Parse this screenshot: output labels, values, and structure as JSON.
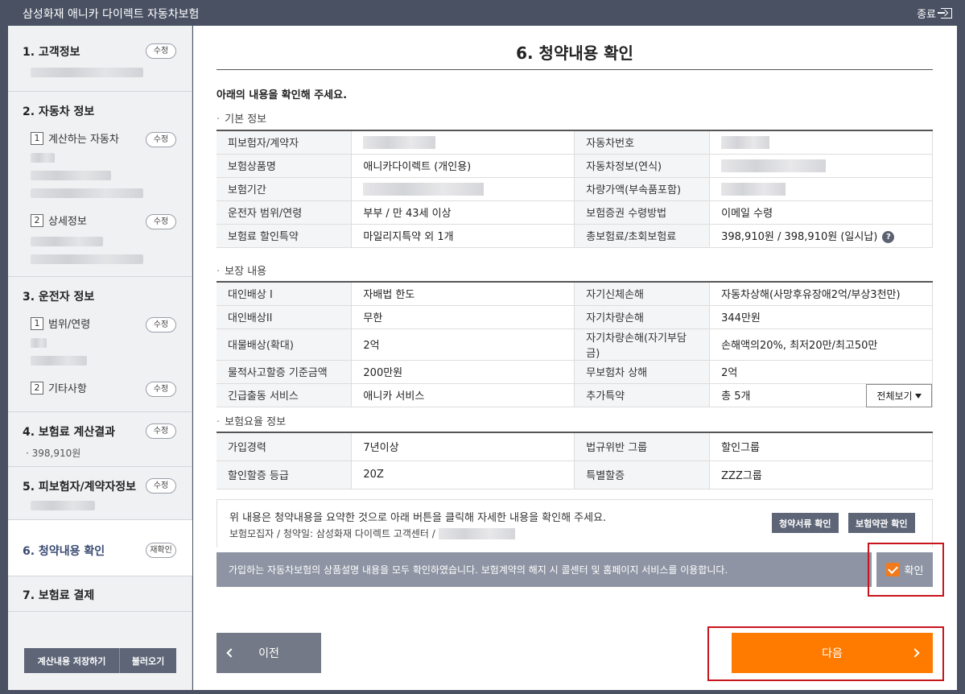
{
  "app": {
    "title": "삼성화재 애니카 다이렉트 자동차보험",
    "close_label": "종료"
  },
  "sidebar": {
    "s1_title": "1. 고객정보",
    "edit_label": "수정",
    "s2_title": "2. 자동차 정보",
    "s2_sub1_num": "1",
    "s2_sub1": "계산하는 자동차",
    "s2_sub2_num": "2",
    "s2_sub2": "상세정보",
    "s3_title": "3. 운전자 정보",
    "s3_sub1_num": "1",
    "s3_sub1": "범위/연령",
    "s3_sub2_num": "2",
    "s3_sub2": "기타사항",
    "s4_title": "4. 보험료 계산결과",
    "s4_note": "· 398,910원",
    "s5_title": "5. 피보험자/계약자정보",
    "s6_title": "6. 청약내용 확인",
    "recheck_label": "재확인",
    "s7_title": "7. 보험료 결제",
    "save_label": "계산내용 저장하기",
    "load_label": "불러오기"
  },
  "main": {
    "page_title": "6. 청약내용 확인",
    "intro": "아래의 내용을 확인해 주세요.",
    "basic_label": "기본 정보",
    "basic": [
      [
        "피보험자/계약자",
        "",
        "자동차번호",
        ""
      ],
      [
        "보험상품명",
        "애니카다이렉트 (개인용)",
        "자동차정보(연식)",
        ""
      ],
      [
        "보험기간",
        "",
        "차량가액(부속품포함)",
        ""
      ],
      [
        "운전자 범위/연령",
        "부부 / 만 43세 이상",
        "보험증권 수령방법",
        "이메일 수령"
      ],
      [
        "보험료 할인특약",
        "마일리지특약 외 1개",
        "총보험료/초회보험료",
        "398,910원 / 398,910원 (일시납)"
      ]
    ],
    "coverage_label": "보장 내용",
    "coverage": [
      [
        "대인배상 I",
        "자배법 한도",
        "자기신체손해",
        "자동차상해(사망후유장애2억/부상3천만)"
      ],
      [
        "대인배상II",
        "무한",
        "자기차량손해",
        "344만원"
      ],
      [
        "대물배상(확대)",
        "2억",
        "자기차량손해(자기부담금)",
        "손해액의20%, 최저20만/최고50만"
      ],
      [
        "물적사고할증 기준금액",
        "200만원",
        "무보험차 상해",
        "2억"
      ],
      [
        "긴급출동 서비스",
        "애니카 서비스",
        "추가특약",
        "총 5개"
      ]
    ],
    "viewall_label": "전체보기",
    "rate_label": "보험요율 정보",
    "rate": [
      [
        "가입경력",
        "7년이상",
        "법규위반 그룹",
        "할인그룹"
      ],
      [
        "할인할증 등급",
        "20Z",
        "특별할증",
        "ZZZ그룹"
      ]
    ],
    "notice_line1": "위 내용은 청약내용을 요약한 것으로 아래 버튼을 클릭해 자세한 내용을 확인해 주세요.",
    "notice_line2": "보험모집자 / 청약일: 삼성화재 다이렉트 고객센터 /",
    "doc_btn1": "청약서류 확인",
    "doc_btn2": "보험약관 확인",
    "confirm_msg": "가입하는 자동차보험의 상품설명 내용을 모두 확인하였습니다. 보험계약의 해지 시 콜센터 및 홈페이지 서비스를 이용합니다.",
    "confirm_label": "확인",
    "prev_label": "이전",
    "next_label": "다음"
  },
  "colors": {
    "accent": "#ff7b00",
    "header": "#4a5163",
    "highlight": "#c8141c"
  }
}
